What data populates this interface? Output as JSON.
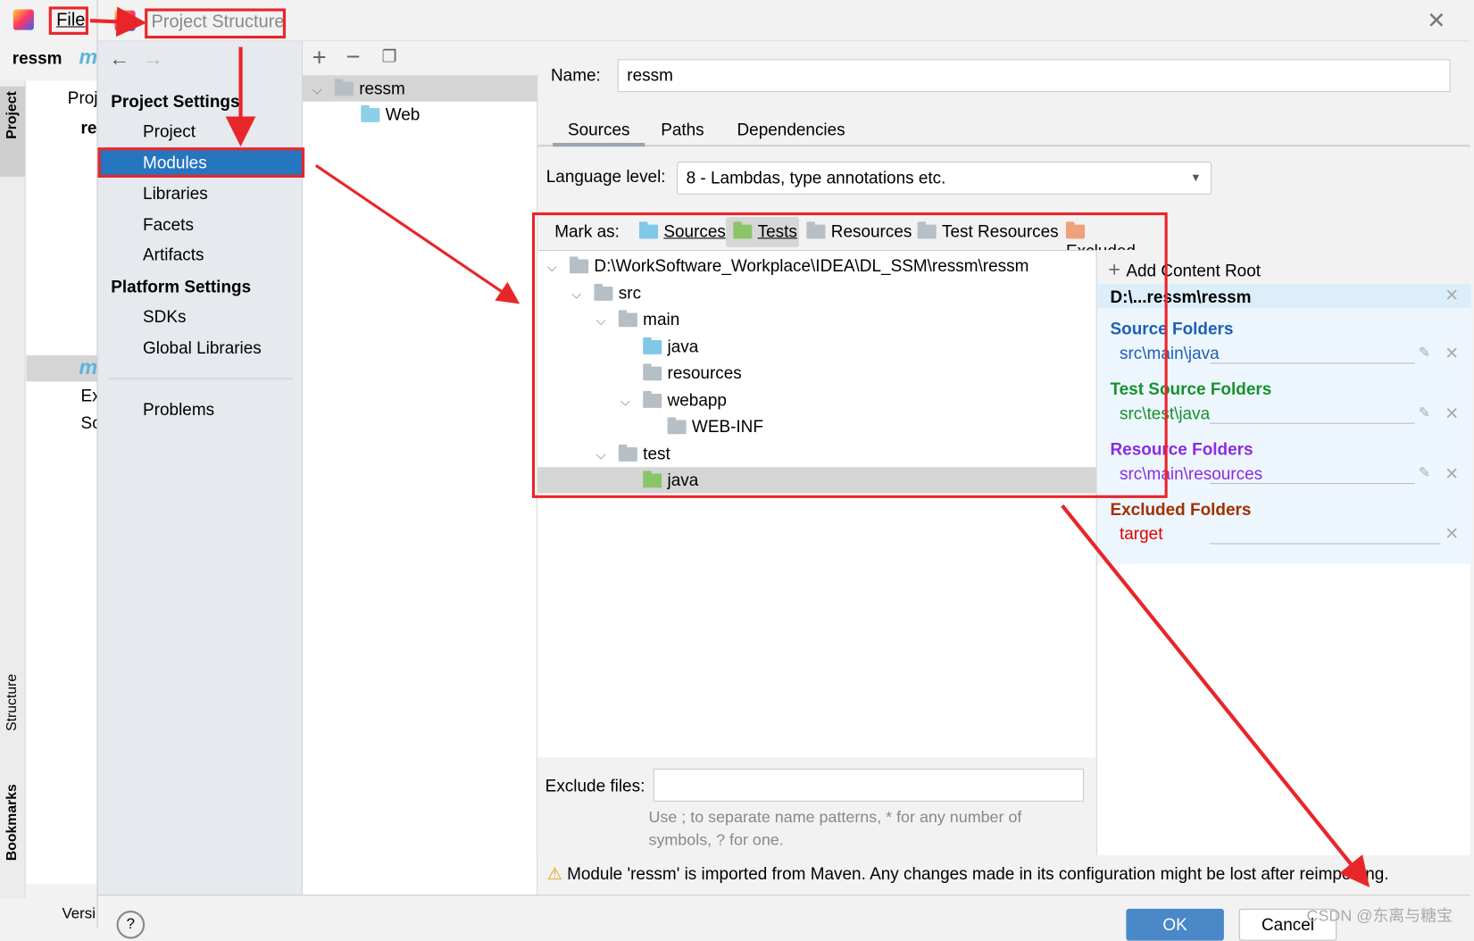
{
  "ide": {
    "menu_file": "File",
    "breadcrumb_project": "ressm",
    "breadcrumb_module": "m",
    "tool_project": "Project",
    "tool_structure": "Structure",
    "tool_bookmarks": "Bookmarks",
    "tree_partial": [
      "Proj",
      "re",
      "m",
      "Ex",
      "Sc"
    ],
    "bottom_version": "Versi"
  },
  "dialog": {
    "title": "Project Structure",
    "nav": {
      "project_settings": "Project Settings",
      "items": [
        "Project",
        "Modules",
        "Libraries",
        "Facets",
        "Artifacts"
      ],
      "platform_settings": "Platform Settings",
      "platform_items": [
        "SDKs",
        "Global Libraries"
      ],
      "problems": "Problems",
      "selected": "Modules"
    },
    "modules": {
      "root": "ressm",
      "child": "Web"
    },
    "name_label": "Name:",
    "name_value": "ressm",
    "tabs": [
      "Sources",
      "Paths",
      "Dependencies"
    ],
    "active_tab": "Sources",
    "language_label": "Language level:",
    "language_value": "8 - Lambdas, type annotations etc.",
    "mark_as": {
      "label": "Mark as:",
      "items": [
        "Sources",
        "Tests",
        "Resources",
        "Test Resources",
        "Excluded"
      ],
      "active": "Tests"
    },
    "tree": [
      {
        "label": "D:\\WorkSoftware_Workplace\\IDEA\\DL_SSM\\ressm\\ressm",
        "depth": 0,
        "expanded": true,
        "kind": "plain"
      },
      {
        "label": "src",
        "depth": 1,
        "expanded": true,
        "kind": "plain"
      },
      {
        "label": "main",
        "depth": 2,
        "expanded": true,
        "kind": "plain"
      },
      {
        "label": "java",
        "depth": 3,
        "kind": "source"
      },
      {
        "label": "resources",
        "depth": 3,
        "kind": "resource"
      },
      {
        "label": "webapp",
        "depth": 3,
        "expanded": true,
        "kind": "plain"
      },
      {
        "label": "WEB-INF",
        "depth": 4,
        "kind": "plain"
      },
      {
        "label": "test",
        "depth": 2,
        "expanded": true,
        "kind": "plain"
      },
      {
        "label": "java",
        "depth": 3,
        "kind": "test",
        "selected": true
      }
    ],
    "content_root": {
      "add": "Add Content Root",
      "root": "D:\\...ressm\\ressm",
      "groups": [
        {
          "title": "Source Folders",
          "path": "src\\main\\java",
          "color": "#1f5fb3"
        },
        {
          "title": "Test Source Folders",
          "path": "src\\test\\java",
          "color": "#14922e"
        },
        {
          "title": "Resource Folders",
          "path": "src\\main\\resources",
          "color": "#8a2be2"
        },
        {
          "title": "Excluded Folders",
          "path": "target",
          "color": "#a03000",
          "path_color": "#e00000"
        }
      ]
    },
    "exclude_label": "Exclude files:",
    "exclude_value": "",
    "exclude_hint": "Use ; to separate name patterns, * for any number of symbols, ? for one.",
    "warning": "Module 'ressm' is imported from Maven. Any changes made in its configuration might be lost after reimporting.",
    "ok": "OK",
    "cancel": "Cancel"
  },
  "watermark": "CSDN @东离与糖宝",
  "colors": {
    "selection": "#2675bf",
    "annotation": "#e8262a",
    "source": "#7fc8e8",
    "test": "#8cc46a",
    "excluded": "#f0a07a"
  }
}
